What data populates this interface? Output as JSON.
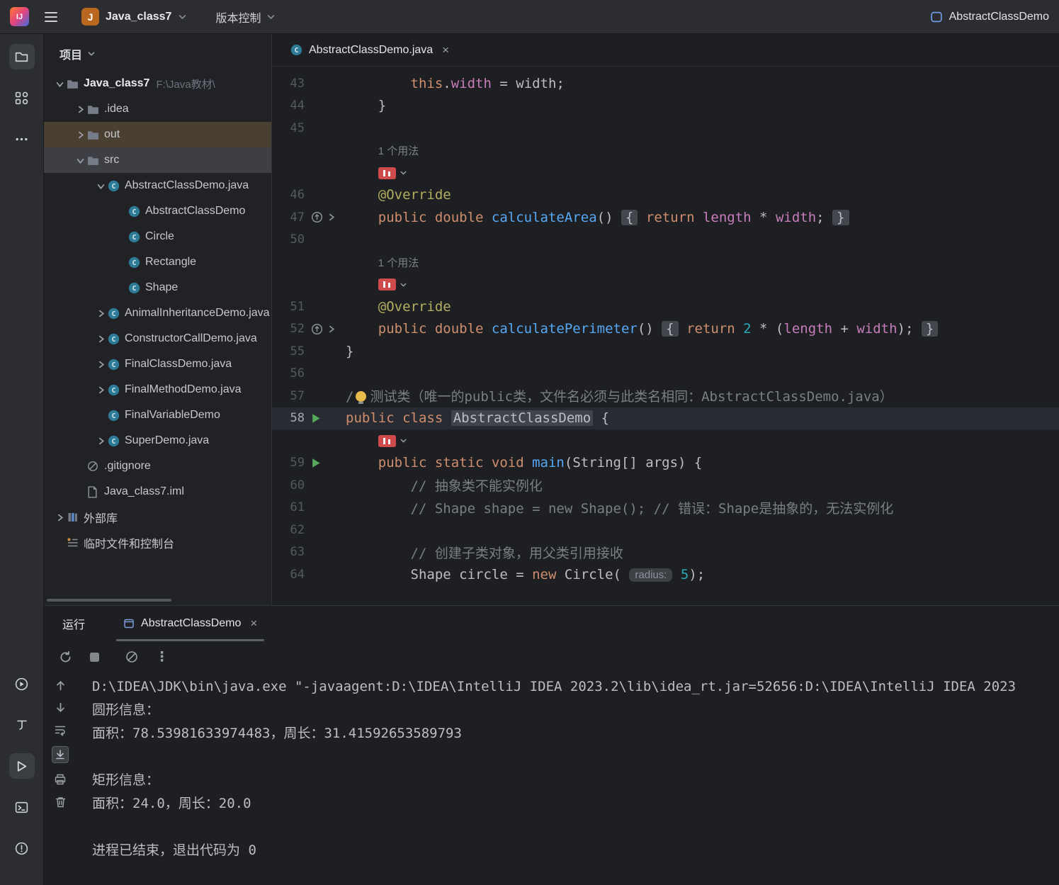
{
  "title_bar": {
    "logo": "IJ",
    "project_badge_letter": "J",
    "project_name": "Java_class7",
    "vcs_label": "版本控制",
    "run_config": "AbstractClassDemo"
  },
  "activity_bar": {
    "top": [
      {
        "name": "project-tool",
        "icon": "project",
        "active": true
      },
      {
        "name": "commit-tool",
        "icon": "commit",
        "active": false
      },
      {
        "name": "more-tools",
        "icon": "more",
        "active": false
      }
    ],
    "bottom": [
      {
        "name": "services-tool",
        "icon": "services",
        "active": false
      },
      {
        "name": "profiler-tool",
        "icon": "profiler",
        "active": false
      },
      {
        "name": "run-tool",
        "icon": "runwin",
        "active": true
      },
      {
        "name": "terminal-tool",
        "icon": "terminal",
        "active": false
      },
      {
        "name": "problems-tool",
        "icon": "problems",
        "active": false
      }
    ]
  },
  "project": {
    "header": "项目",
    "items": [
      {
        "label": "Java_class7",
        "extra": "F:\\Java教材\\",
        "icon": "folder",
        "level": 0,
        "chev": "open",
        "bold": true
      },
      {
        "label": ".idea",
        "icon": "folder",
        "level": 1,
        "chev": "closed"
      },
      {
        "label": "out",
        "icon": "folder",
        "level": 1,
        "chev": "closed",
        "hl": "warm"
      },
      {
        "label": "src",
        "icon": "folder",
        "level": 1,
        "chev": "open",
        "hl": "selected"
      },
      {
        "label": "AbstractClassDemo.java",
        "icon": "class",
        "level": 2,
        "chev": "open"
      },
      {
        "label": "AbstractClassDemo",
        "icon": "class",
        "level": 3
      },
      {
        "label": "Circle",
        "icon": "class",
        "level": 3
      },
      {
        "label": "Rectangle",
        "icon": "class",
        "level": 3
      },
      {
        "label": "Shape",
        "icon": "class",
        "level": 3
      },
      {
        "label": "AnimalInheritanceDemo.java",
        "icon": "class",
        "level": 2,
        "chev": "closed"
      },
      {
        "label": "ConstructorCallDemo.java",
        "icon": "class",
        "level": 2,
        "chev": "closed"
      },
      {
        "label": "FinalClassDemo.java",
        "icon": "class",
        "level": 2,
        "chev": "closed"
      },
      {
        "label": "FinalMethodDemo.java",
        "icon": "class",
        "level": 2,
        "chev": "closed"
      },
      {
        "label": "FinalVariableDemo",
        "icon": "class",
        "level": 2
      },
      {
        "label": "SuperDemo.java",
        "icon": "class",
        "level": 2,
        "chev": "closed"
      },
      {
        "label": ".gitignore",
        "icon": "ignore",
        "level": 1
      },
      {
        "label": "Java_class7.iml",
        "icon": "file",
        "level": 1
      },
      {
        "label": "外部库",
        "icon": "lib",
        "level": 0,
        "chev": "closed"
      },
      {
        "label": "临时文件和控制台",
        "icon": "scratch",
        "level": 0
      }
    ]
  },
  "editor": {
    "tab_title": "AbstractClassDemo.java",
    "usage_hint": "1 个用法",
    "rows": [
      {
        "n": "43",
        "seg": [
          [
            "        ",
            "pln"
          ],
          [
            "this",
            "kw"
          ],
          [
            ".",
            "pln"
          ],
          [
            "width",
            "fld"
          ],
          [
            " = width;",
            "pln"
          ]
        ]
      },
      {
        "n": "44",
        "seg": [
          [
            "    }",
            "pln"
          ]
        ]
      },
      {
        "n": "45",
        "seg": []
      },
      {
        "n": "",
        "seg": [
          [
            "    ",
            "pln"
          ],
          [
            "1 个用法",
            "usage"
          ]
        ]
      },
      {
        "n": "",
        "seg": [
          [
            "    ",
            "pln"
          ],
          [
            "",
            "badge"
          ]
        ]
      },
      {
        "n": "46",
        "seg": [
          [
            "    ",
            "pln"
          ],
          [
            "@Override",
            "ann"
          ]
        ]
      },
      {
        "n": "47",
        "g": [
          "override",
          "fold"
        ],
        "seg": [
          [
            "    ",
            "pln"
          ],
          [
            "public double ",
            "kw"
          ],
          [
            "calculateArea",
            "fn"
          ],
          [
            "() ",
            "pln"
          ],
          [
            "{",
            "foldc"
          ],
          [
            " ",
            "pln"
          ],
          [
            "return",
            "kw"
          ],
          [
            " ",
            "pln"
          ],
          [
            "length",
            "fld"
          ],
          [
            " * ",
            "pln"
          ],
          [
            "width",
            "fld"
          ],
          [
            ";",
            "pln"
          ],
          [
            " ",
            "pln"
          ],
          [
            "}",
            "foldc"
          ]
        ]
      },
      {
        "n": "50",
        "seg": []
      },
      {
        "n": "",
        "seg": [
          [
            "    ",
            "pln"
          ],
          [
            "1 个用法",
            "usage"
          ]
        ]
      },
      {
        "n": "",
        "seg": [
          [
            "    ",
            "pln"
          ],
          [
            "",
            "badge"
          ]
        ]
      },
      {
        "n": "51",
        "seg": [
          [
            "    ",
            "pln"
          ],
          [
            "@Override",
            "ann"
          ]
        ]
      },
      {
        "n": "52",
        "g": [
          "override",
          "fold"
        ],
        "seg": [
          [
            "    ",
            "pln"
          ],
          [
            "public double ",
            "kw"
          ],
          [
            "calculatePerimeter",
            "fn"
          ],
          [
            "() ",
            "pln"
          ],
          [
            "{",
            "foldc"
          ],
          [
            " ",
            "pln"
          ],
          [
            "return",
            "kw"
          ],
          [
            " ",
            "pln"
          ],
          [
            "2",
            "num"
          ],
          [
            " * (",
            "pln"
          ],
          [
            "length",
            "fld"
          ],
          [
            " + ",
            "pln"
          ],
          [
            "width",
            "fld"
          ],
          [
            ");",
            "pln"
          ],
          [
            " ",
            "pln"
          ],
          [
            "}",
            "foldc"
          ]
        ]
      },
      {
        "n": "55",
        "seg": [
          [
            "}",
            "pln"
          ]
        ]
      },
      {
        "n": "56",
        "seg": []
      },
      {
        "n": "57",
        "seg": [
          [
            "/",
            "cmt"
          ],
          [
            "",
            "bulb"
          ],
          [
            "测试类（唯一的public类，文件名必须与此类名相同：AbstractClassDemo.java）",
            "cmt"
          ]
        ]
      },
      {
        "n": "58",
        "cur": true,
        "g": [
          "run"
        ],
        "seg": [
          [
            "public class ",
            "kw"
          ],
          [
            "AbstractClassDemo",
            "idhl"
          ],
          [
            " {",
            "pln"
          ]
        ]
      },
      {
        "n": "",
        "seg": [
          [
            "    ",
            "pln"
          ],
          [
            "",
            "badge"
          ]
        ]
      },
      {
        "n": "59",
        "g": [
          "run"
        ],
        "seg": [
          [
            "    ",
            "pln"
          ],
          [
            "public static void ",
            "kw"
          ],
          [
            "main",
            "fn"
          ],
          [
            "(String[] args) {",
            "pln"
          ]
        ]
      },
      {
        "n": "60",
        "seg": [
          [
            "        ",
            "pln"
          ],
          [
            "// 抽象类不能实例化",
            "cmt"
          ]
        ]
      },
      {
        "n": "61",
        "seg": [
          [
            "        ",
            "pln"
          ],
          [
            "// Shape shape = new Shape(); // 错误：Shape是抽象的，无法实例化",
            "cmt"
          ]
        ]
      },
      {
        "n": "62",
        "seg": []
      },
      {
        "n": "63",
        "seg": [
          [
            "        ",
            "pln"
          ],
          [
            "// 创建子类对象，用父类引用接收",
            "cmt"
          ]
        ]
      },
      {
        "n": "64",
        "seg": [
          [
            "        Shape circle = ",
            "pln"
          ],
          [
            "new",
            "kw"
          ],
          [
            " Circle( ",
            "pln"
          ],
          [
            "radius:",
            "hint"
          ],
          [
            " ",
            "pln"
          ],
          [
            "5",
            "num"
          ],
          [
            ");",
            "pln"
          ]
        ]
      }
    ]
  },
  "run_panel": {
    "label": "运行",
    "tab": "AbstractClassDemo",
    "toolbar": [
      {
        "name": "rerun",
        "icon": "rerun"
      },
      {
        "name": "stop",
        "icon": "stop"
      },
      {
        "name": "clear-all",
        "icon": "clearall",
        "sep": true
      },
      {
        "name": "more-options",
        "icon": "kebab"
      }
    ],
    "strip": [
      {
        "name": "navigate-up",
        "icon": "up"
      },
      {
        "name": "navigate-down",
        "icon": "down"
      },
      {
        "name": "soft-wrap",
        "icon": "softwrap"
      },
      {
        "name": "scroll-to-end",
        "icon": "scrollend",
        "active": true
      },
      {
        "name": "print",
        "icon": "printer"
      },
      {
        "name": "clear-console",
        "icon": "trash"
      }
    ],
    "console": [
      "D:\\IDEA\\JDK\\bin\\java.exe \"-javaagent:D:\\IDEA\\IntelliJ IDEA 2023.2\\lib\\idea_rt.jar=52656:D:\\IDEA\\IntelliJ IDEA 2023",
      "圆形信息：",
      "面积：78.53981633974483，周长：31.41592653589793",
      "",
      "矩形信息：",
      "面积：24.0，周长：20.0",
      "",
      "进程已结束，退出代码为 0"
    ]
  },
  "colors": {
    "accent": "#3574f0",
    "run_green": "#57a85c",
    "badge_red": "#cf4b4b",
    "editor_bg": "#1e1f22",
    "panel_bg": "#2b2d30"
  }
}
